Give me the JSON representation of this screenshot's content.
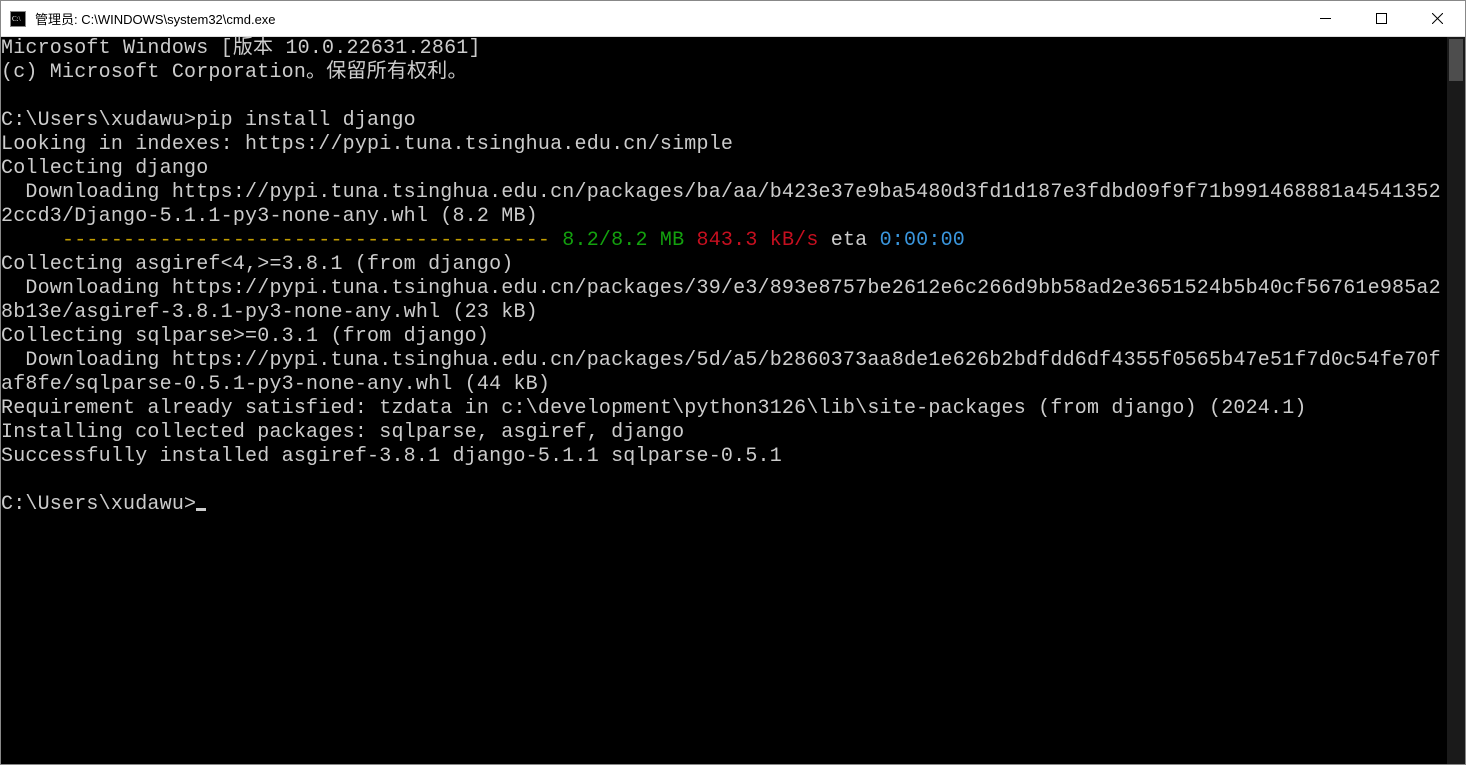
{
  "window": {
    "title": "管理员: C:\\WINDOWS\\system32\\cmd.exe"
  },
  "term": {
    "banner1": "Microsoft Windows [版本 10.0.22631.2861]",
    "banner2": "(c) Microsoft Corporation。保留所有权利。",
    "prompt1_path": "C:\\Users\\xudawu>",
    "prompt1_cmd": "pip install django",
    "l_indexes": "Looking in indexes: https://pypi.tuna.tsinghua.edu.cn/simple",
    "l_collect_django": "Collecting django",
    "l_dl_django": "  Downloading https://pypi.tuna.tsinghua.edu.cn/packages/ba/aa/b423e37e9ba5480d3fd1d187e3fdbd09f9f71b991468881a45413522ccd3/Django-5.1.1-py3-none-any.whl (8.2 MB)",
    "progress": {
      "indent": "     ",
      "bar": "---------------------------------------- ",
      "size": "8.2/8.2 MB",
      "speed": " 843.3 kB/s",
      "eta_label": " eta ",
      "eta_value": "0:00:00"
    },
    "l_collect_asgiref": "Collecting asgiref<4,>=3.8.1 (from django)",
    "l_dl_asgiref": "  Downloading https://pypi.tuna.tsinghua.edu.cn/packages/39/e3/893e8757be2612e6c266d9bb58ad2e3651524b5b40cf56761e985a28b13e/asgiref-3.8.1-py3-none-any.whl (23 kB)",
    "l_collect_sqlparse": "Collecting sqlparse>=0.3.1 (from django)",
    "l_dl_sqlparse": "  Downloading https://pypi.tuna.tsinghua.edu.cn/packages/5d/a5/b2860373aa8de1e626b2bdfdd6df4355f0565b47e51f7d0c54fe70faf8fe/sqlparse-0.5.1-py3-none-any.whl (44 kB)",
    "l_req_satisfied": "Requirement already satisfied: tzdata in c:\\development\\python3126\\lib\\site-packages (from django) (2024.1)",
    "l_installing": "Installing collected packages: sqlparse, asgiref, django",
    "l_success": "Successfully installed asgiref-3.8.1 django-5.1.1 sqlparse-0.5.1",
    "prompt2_path": "C:\\Users\\xudawu>"
  }
}
